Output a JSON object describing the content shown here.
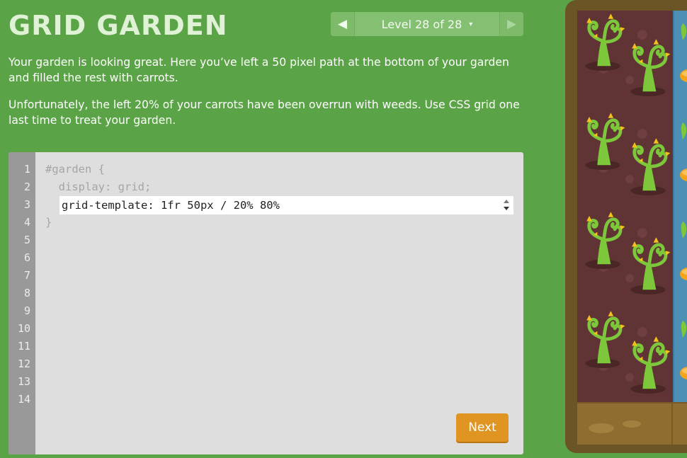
{
  "app": {
    "title": "GRID GARDEN"
  },
  "level_nav": {
    "prev_icon": "◀",
    "next_icon": "▶",
    "indicator_label": "Level 28 of 28",
    "caret": "▾"
  },
  "instructions": [
    "Your garden is looking great. Here you’ve left a 50 pixel path at the bottom of your garden and filled the rest with carrots.",
    "Unfortunately, the left 20% of your carrots have been overrun with weeds. Use CSS grid one last time to treat your garden."
  ],
  "editor": {
    "line_numbers": [
      "1",
      "2",
      "3",
      "4",
      "5",
      "6",
      "7",
      "8",
      "9",
      "10",
      "11",
      "12",
      "13",
      "14"
    ],
    "line1": "#garden {",
    "line2": "  display: grid;",
    "input_value": "grid-template: 1fr 50px / 20% 80%",
    "line4": "}",
    "next_label": "Next"
  },
  "garden": {
    "weed_icon": "weed-icon",
    "carrot_icon": "carrot-icon",
    "colors": {
      "soil": "#603435",
      "weed": "#7dc83a",
      "thorn": "#f2c21b",
      "water": "#4e90b5",
      "path": "#8f6c30",
      "frame": "#6b5426"
    }
  },
  "colors": {
    "background": "#5ba347",
    "accent": "#e09421",
    "title": "#dff2d6"
  }
}
